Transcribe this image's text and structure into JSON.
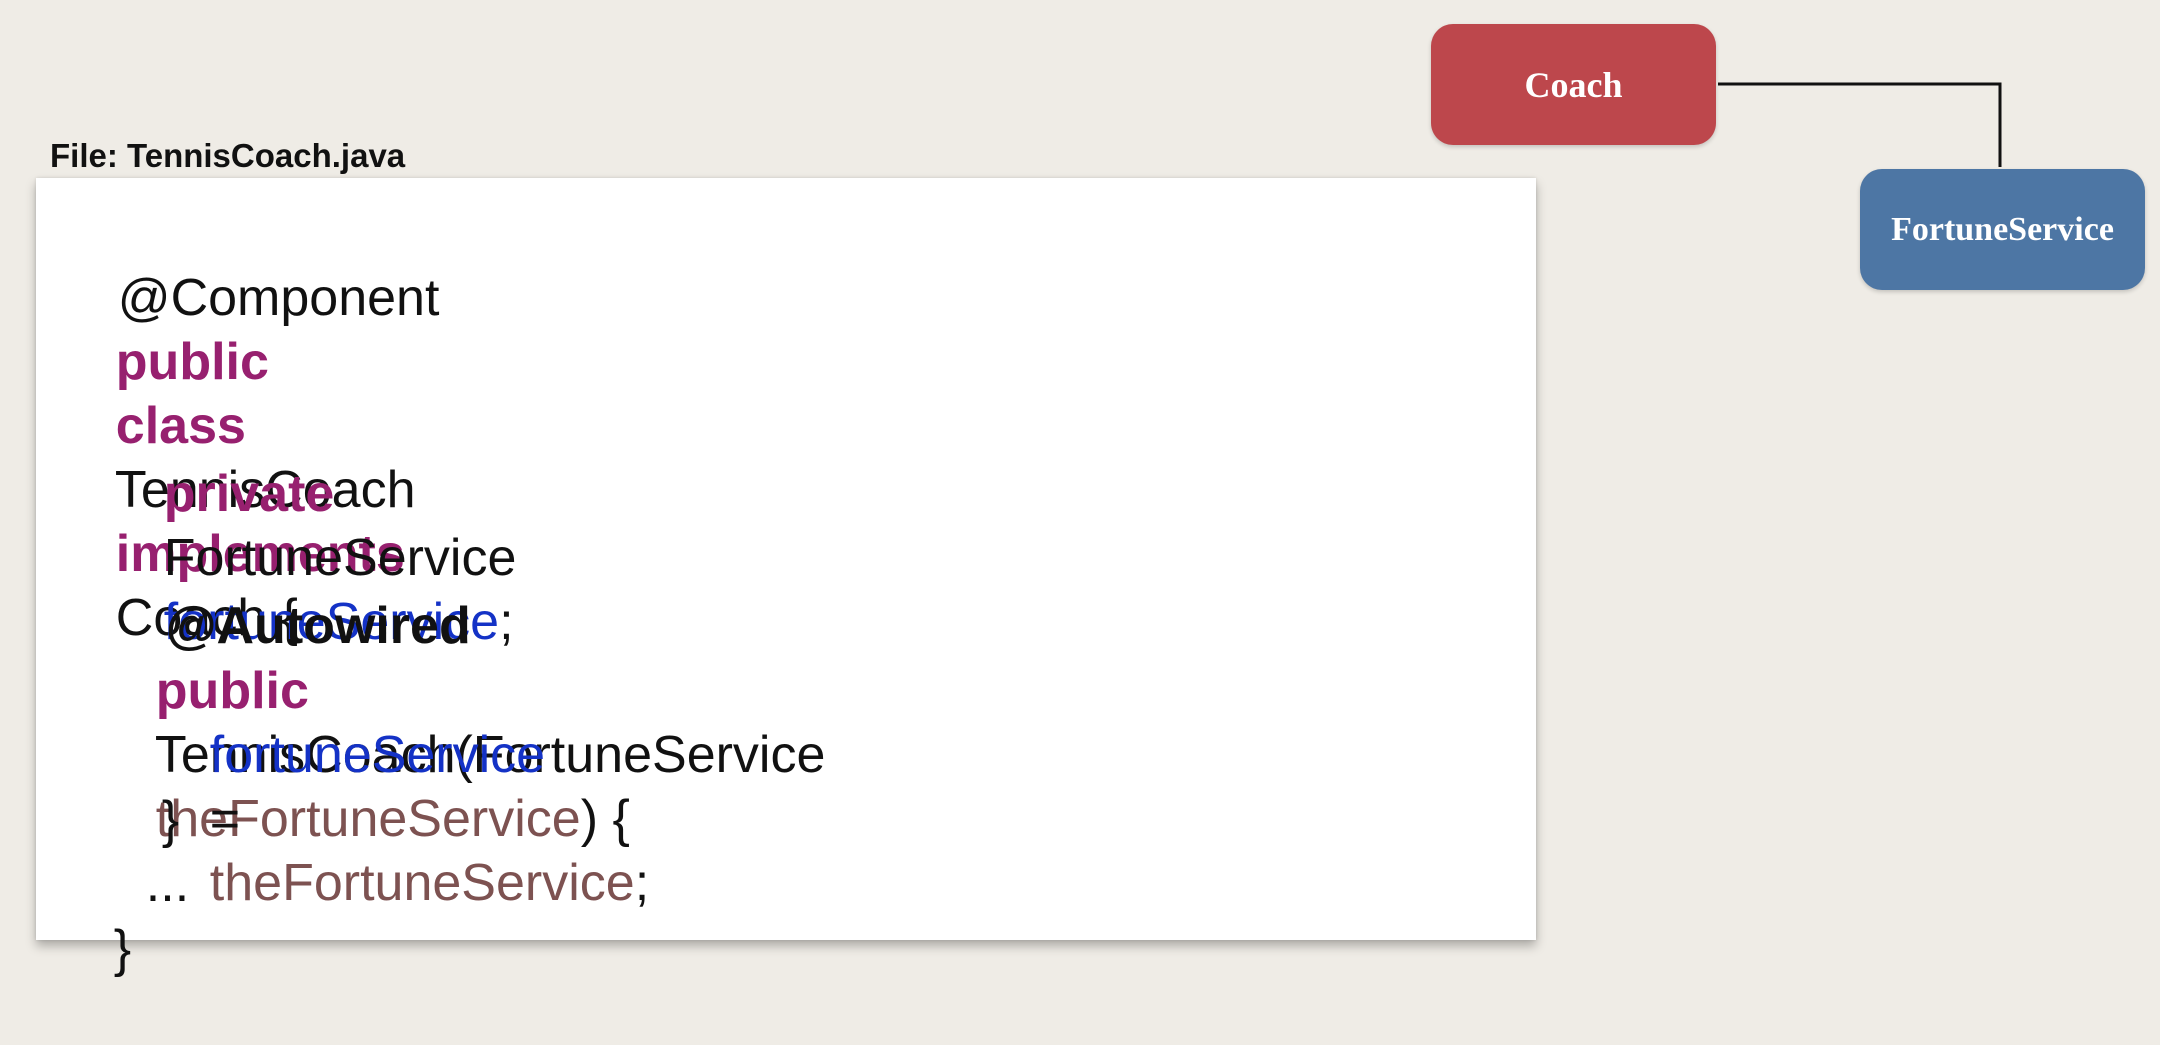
{
  "file_label": "File: TennisCoach.java",
  "code": {
    "line1": {
      "annotation": "@Component"
    },
    "line2": {
      "kw1": "public",
      "kw2": "class",
      "name": "TennisCoach",
      "kw3": "implements",
      "rest": "Coach {"
    },
    "line3": {
      "kw": "private",
      "type": "FortuneService",
      "field": "fortuneService",
      "end": ";"
    },
    "line4": {
      "annotation": "@Autowired"
    },
    "line5": {
      "kw": "public",
      "sig": "TennisCoach(FortuneService",
      "param": "theFortuneService",
      "end": ") {"
    },
    "line6": {
      "field": "fortuneService",
      "eq": "=",
      "param": "theFortuneService",
      "end": ";"
    },
    "line7": {
      "brace": "}"
    },
    "line8": {
      "ellipsis": "..."
    },
    "line9": {
      "brace": "}"
    }
  },
  "diagram": {
    "coach_label": "Coach",
    "fortune_label": "FortuneService",
    "colors": {
      "coach": "#bd474c",
      "fortune": "#4d76a4",
      "keyword": "#97206f",
      "field": "#1432c6",
      "param": "#7d5251"
    }
  }
}
